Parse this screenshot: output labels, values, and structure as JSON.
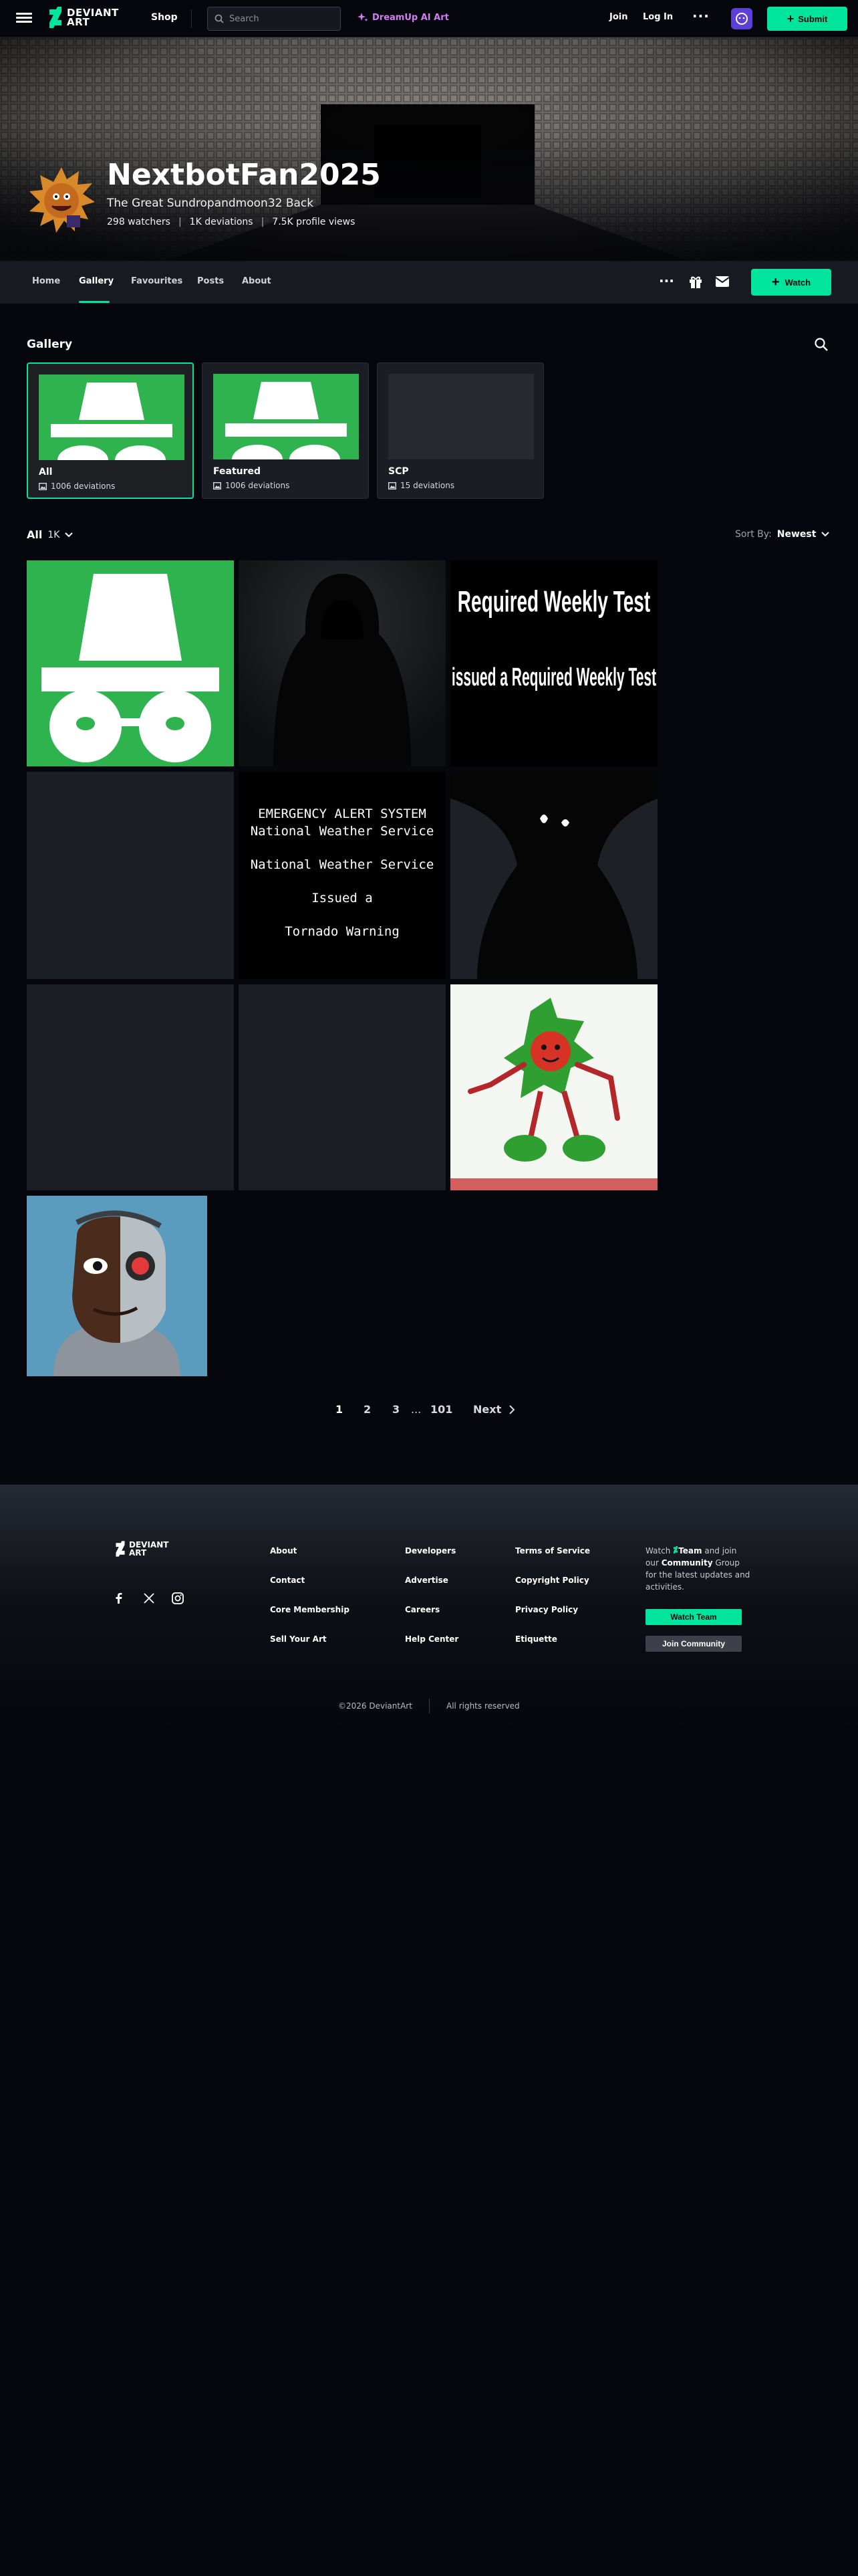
{
  "topbar": {
    "shop_label": "Shop",
    "search_placeholder": "Search",
    "dreamup_label": "DreamUp AI Art",
    "join_label": "Join",
    "login_label": "Log In",
    "submit_label": "Submit",
    "logo_text_1": "DEVIANT",
    "logo_text_2": "ART"
  },
  "profile": {
    "username": "NextbotFan2025",
    "tagline": "The Great Sundropandmoon32 Back",
    "watchers": "298 watchers",
    "deviations": "1K deviations",
    "views": "7.5K profile views"
  },
  "subnav": {
    "tabs": [
      {
        "label": "Home"
      },
      {
        "label": "Gallery"
      },
      {
        "label": "Favourites"
      },
      {
        "label": "Posts"
      },
      {
        "label": "About"
      }
    ],
    "watch_label": "Watch"
  },
  "gallery": {
    "title": "Gallery",
    "folders": [
      {
        "name": "All",
        "count": "1006 deviations"
      },
      {
        "name": "Featured",
        "count": "1006 deviations"
      },
      {
        "name": "SCP",
        "count": "15 deviations"
      }
    ],
    "filter_label": "All",
    "filter_count": "1K",
    "sort_label": "Sort By:",
    "sort_value": "Newest",
    "text_tiles": {
      "weekly_line1": "Required Weekly Test",
      "weekly_line2": "issued a Required Weekly Test",
      "eas_line1": "EMERGENCY ALERT SYSTEM",
      "eas_line2": "National Weather Service",
      "eas_line3": "National Weather Service",
      "eas_line4": "Issued a",
      "eas_line5": "Tornado Warning"
    }
  },
  "pagination": {
    "pages": [
      "1",
      "2",
      "3"
    ],
    "ellipsis": "...",
    "last": "101",
    "next": "Next"
  },
  "footer": {
    "col1": [
      "About",
      "Contact",
      "Core Membership",
      "Sell Your Art"
    ],
    "col2": [
      "Developers",
      "Advertise",
      "Careers",
      "Help Center"
    ],
    "col3": [
      "Terms of Service",
      "Copyright Policy",
      "Privacy Policy",
      "Etiquette"
    ],
    "watch_pre": "Watch ",
    "team_word": "Team",
    "watch_mid": " and join our ",
    "community_word": "Community",
    "watch_post": " Group for the latest updates and activities.",
    "watch_team_label": "Watch Team",
    "join_community_label": "Join Community",
    "copyright": "©2026 DeviantArt",
    "rights": "All rights reserved"
  },
  "colors": {
    "accent": "#00e59b",
    "background": "#06070d",
    "dreamup": "#d37cf4",
    "incognito_green": "#2fb34f"
  }
}
